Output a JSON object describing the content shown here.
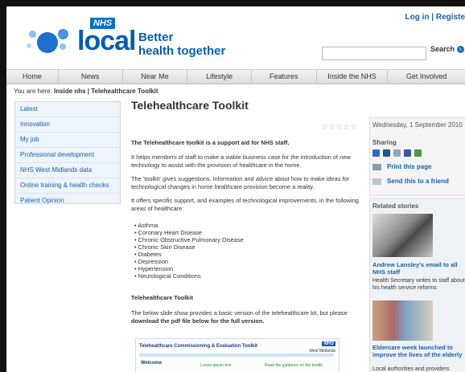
{
  "header": {
    "logo_nhs": "NHS",
    "logo_local": "local",
    "tagline_line1": "Better",
    "tagline_line2": "health together",
    "login_label": "Log in | Registe",
    "search_button_label": "Search",
    "search_go_glyph": "›",
    "search_placeholder": ""
  },
  "nav": {
    "items": [
      "Home",
      "News",
      "Near Me",
      "Lifestyle",
      "Features",
      "Inside the NHS",
      "Get Involved"
    ]
  },
  "breadcrumb": {
    "prefix": "You are here:",
    "path": "Inside nhs | Telehealthcare Toolkit"
  },
  "sidebar": {
    "items": [
      "Latest",
      "Innovation",
      "My job",
      "Professional development",
      "NHS West Midlands data",
      "Online training & health checks",
      "Patient Opinion"
    ]
  },
  "main": {
    "title": "Telehealthcare Toolkit",
    "stars": "☆☆☆☆☆",
    "intro": "The Telehealthcare toolkit is a support aid for NHS staff.",
    "para1": "It helps members of staff to make a viable business case for the introduction of new technology to assist with the provision of healthcare in the home.",
    "para2": "The 'toolkit' gives suggestions, information and advice about how to make ideas for technological changes in home healthcare provision become a reality.",
    "para3": "It offers specific support, and examples of technological improvements, in the following areas of healthcare:",
    "conditions": [
      "Asthma",
      "Coronary Heart Disease",
      "Chronic Obstructive Pulmonary Disease",
      "Chronic Skin Disease",
      "Diabetes",
      "Depression",
      "Hypertension",
      "Neurological Conditions"
    ],
    "subheading": "Telehealthcare Toolkit",
    "para4_start": "The below slide show provides a basic version of the telehealthcare kit, but please",
    "para4_bold": "download the pdf file below for the full version.",
    "slide": {
      "title": "Telehealthcare Commissioning & Evaluation Toolkit",
      "nhs": "NHS",
      "sub": "West Midlands",
      "welcome": "Welcome",
      "col2": "Lorem ipsum text",
      "col3": "Read the guidance on the toolkit"
    }
  },
  "right": {
    "date": "Wednesday, 1 September 2010",
    "sharing": "Sharing",
    "share_icons": [
      {
        "name": "delicious",
        "color": "#3366cc"
      },
      {
        "name": "digg",
        "color": "#1b5891"
      },
      {
        "name": "reddit",
        "color": "#8fa6bf"
      },
      {
        "name": "facebook",
        "color": "#3b5998"
      },
      {
        "name": "stumbleupon",
        "color": "#4a9a3b"
      }
    ],
    "print_label": "Print this page",
    "send_label": "Send this to a friend",
    "related_heading": "Related stories",
    "story1_title": "Andrew Lansley's email to all NHS staff",
    "story1_desc": "Health Secretary writes to staff about his health service reforms",
    "story2_title": "Eldercare week launched to improve the lives of the elderly",
    "story2_desc": "Local authorities and providers"
  },
  "colors": {
    "brand_blue": "#005eb8",
    "link_blue": "#1a5fa8"
  }
}
